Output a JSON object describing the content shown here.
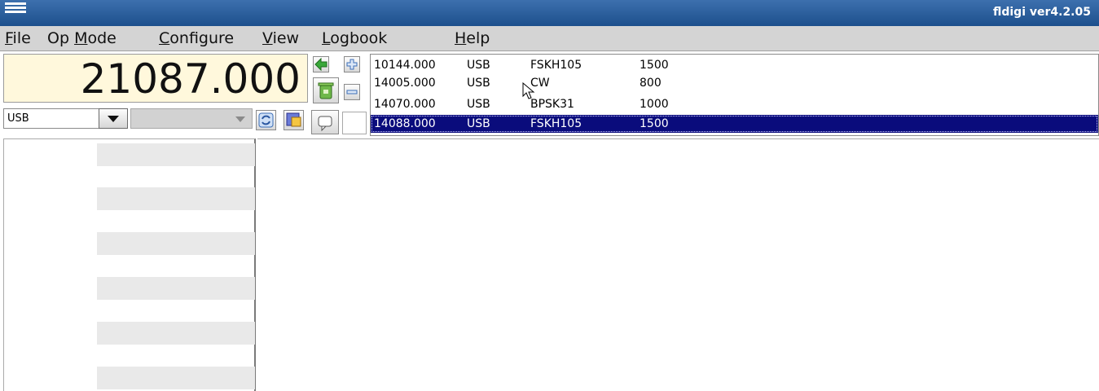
{
  "window": {
    "title": "fldigi ver4.2.05"
  },
  "menu": {
    "file": {
      "accel": "F",
      "rest": "ile"
    },
    "opmode": {
      "before": "Op ",
      "accel": "M",
      "rest": "ode"
    },
    "configure": {
      "accel": "C",
      "rest": "onfigure"
    },
    "view": {
      "accel": "V",
      "rest": "iew"
    },
    "logbook": {
      "accel": "L",
      "rest": "ogbook"
    },
    "help": {
      "accel": "H",
      "rest": "elp"
    }
  },
  "rig": {
    "frequency": "21087.000",
    "mode": "USB",
    "bandwidth": ""
  },
  "freq_list": {
    "rows": [
      {
        "freq": "10144.000",
        "mode": "USB",
        "name": "FSKH105",
        "value": "1500",
        "selected": false
      },
      {
        "freq": "14005.000",
        "mode": "USB",
        "name": "CW",
        "value": "800",
        "selected": false
      },
      {
        "freq": "14070.000",
        "mode": "USB",
        "name": "BPSK31",
        "value": "1000",
        "selected": false
      },
      {
        "freq": "14088.000",
        "mode": "USB",
        "name": "FSKH105",
        "value": "1500",
        "selected": true
      }
    ]
  },
  "icons": {
    "back": "left-arrow-icon",
    "add": "plus-icon",
    "delete": "trash-icon",
    "remove": "minus-icon",
    "refresh": "refresh-icon",
    "memory": "memory-icon",
    "note": "comment-icon"
  },
  "colors": {
    "titlebar": "#1c4f8c",
    "freq_bg": "#fff8dc",
    "selection": "#0a0c7c"
  }
}
